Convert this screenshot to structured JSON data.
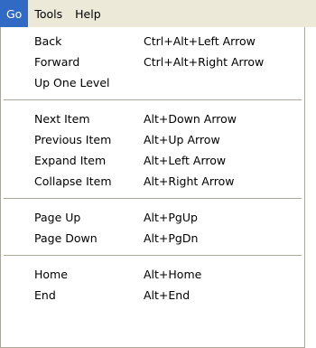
{
  "menubar": {
    "items": [
      {
        "label": "Go",
        "active": true
      },
      {
        "label": "Tools",
        "active": false
      },
      {
        "label": "Help",
        "active": false
      }
    ]
  },
  "colors": {
    "highlight": "#316ac5",
    "menubar_bg": "#ece9d8",
    "separator": "#aca899"
  },
  "menu": {
    "groups": [
      {
        "items": [
          {
            "label": "Back",
            "shortcut": "Ctrl+Alt+Left Arrow"
          },
          {
            "label": "Forward",
            "shortcut": "Ctrl+Alt+Right Arrow"
          },
          {
            "label": "Up One Level",
            "shortcut": ""
          }
        ]
      },
      {
        "items": [
          {
            "label": "Next Item",
            "shortcut": "Alt+Down Arrow"
          },
          {
            "label": "Previous Item",
            "shortcut": "Alt+Up Arrow"
          },
          {
            "label": "Expand Item",
            "shortcut": "Alt+Left Arrow"
          },
          {
            "label": "Collapse Item",
            "shortcut": "Alt+Right Arrow"
          }
        ]
      },
      {
        "items": [
          {
            "label": "Page Up",
            "shortcut": "Alt+PgUp"
          },
          {
            "label": "Page Down",
            "shortcut": "Alt+PgDn"
          }
        ]
      },
      {
        "items": [
          {
            "label": "Home",
            "shortcut": "Alt+Home"
          },
          {
            "label": "End",
            "shortcut": "Alt+End"
          }
        ]
      }
    ]
  }
}
